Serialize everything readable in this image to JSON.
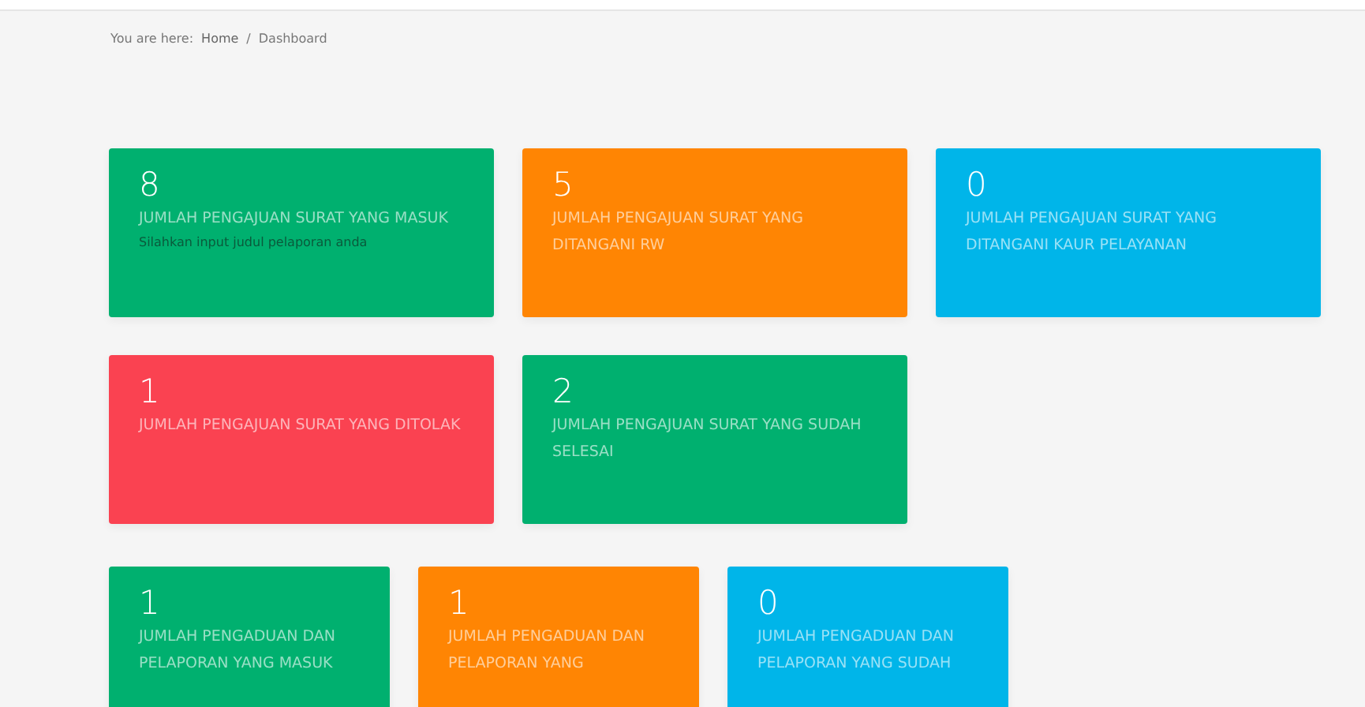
{
  "breadcrumb": {
    "prefix": "You are here:",
    "items": [
      "Home",
      "Dashboard"
    ],
    "separator": "/"
  },
  "sections": [
    {
      "kind": "surat",
      "cards": [
        {
          "value": "8",
          "label": "JUMLAH PENGAJUAN SURAT YANG MASUK",
          "note": "Silahkan input judul pelaporan anda",
          "color": "#00b06f"
        },
        {
          "value": "5",
          "label": "JUMLAH PENGAJUAN SURAT YANG DITANGANI RW",
          "color": "#ff8503"
        },
        {
          "value": "0",
          "label": "JUMLAH PENGAJUAN SURAT YANG DITANGANI KAUR PELAYANAN",
          "color": "#00b5e9"
        },
        {
          "value": "1",
          "label": "JUMLAH PENGAJUAN SURAT YANG DITOLAK",
          "color": "#fa4251"
        },
        {
          "value": "2",
          "label": "JUMLAH PENGAJUAN SURAT YANG SUDAH SELESAI",
          "color": "#00b06f"
        }
      ]
    },
    {
      "kind": "pengaduan",
      "cards": [
        {
          "value": "1",
          "label": "JUMLAH PENGADUAN DAN PELAPORAN YANG MASUK",
          "color": "#00b06f"
        },
        {
          "value": "1",
          "label": "JUMLAH PENGADUAN DAN PELAPORAN YANG",
          "color": "#ff8503"
        },
        {
          "value": "0",
          "label": "JUMLAH PENGADUAN DAN PELAPORAN YANG SUDAH",
          "color": "#00b5e9"
        }
      ]
    }
  ]
}
